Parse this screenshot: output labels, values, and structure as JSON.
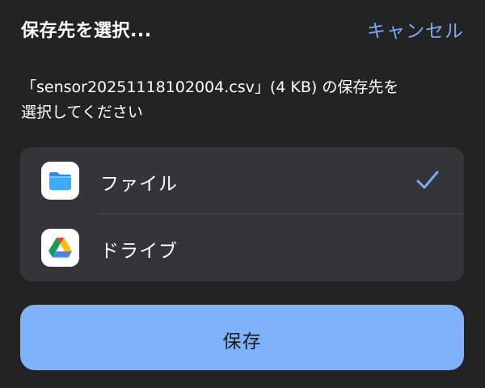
{
  "header": {
    "title": "保存先を選択...",
    "cancel_label": "キャンセル"
  },
  "message": {
    "line1": "「sensor20251118102004.csv」(4 KB) の保存先を",
    "line2": "選択してください"
  },
  "options": [
    {
      "label": "ファイル",
      "icon": "files-app-icon",
      "selected": true
    },
    {
      "label": "ドライブ",
      "icon": "google-drive-icon",
      "selected": false
    }
  ],
  "save_button": {
    "label": "保存"
  },
  "colors": {
    "accent": "#7aaaf5",
    "background": "#232323",
    "panel": "#343538",
    "save_button": "#80b2fb"
  }
}
